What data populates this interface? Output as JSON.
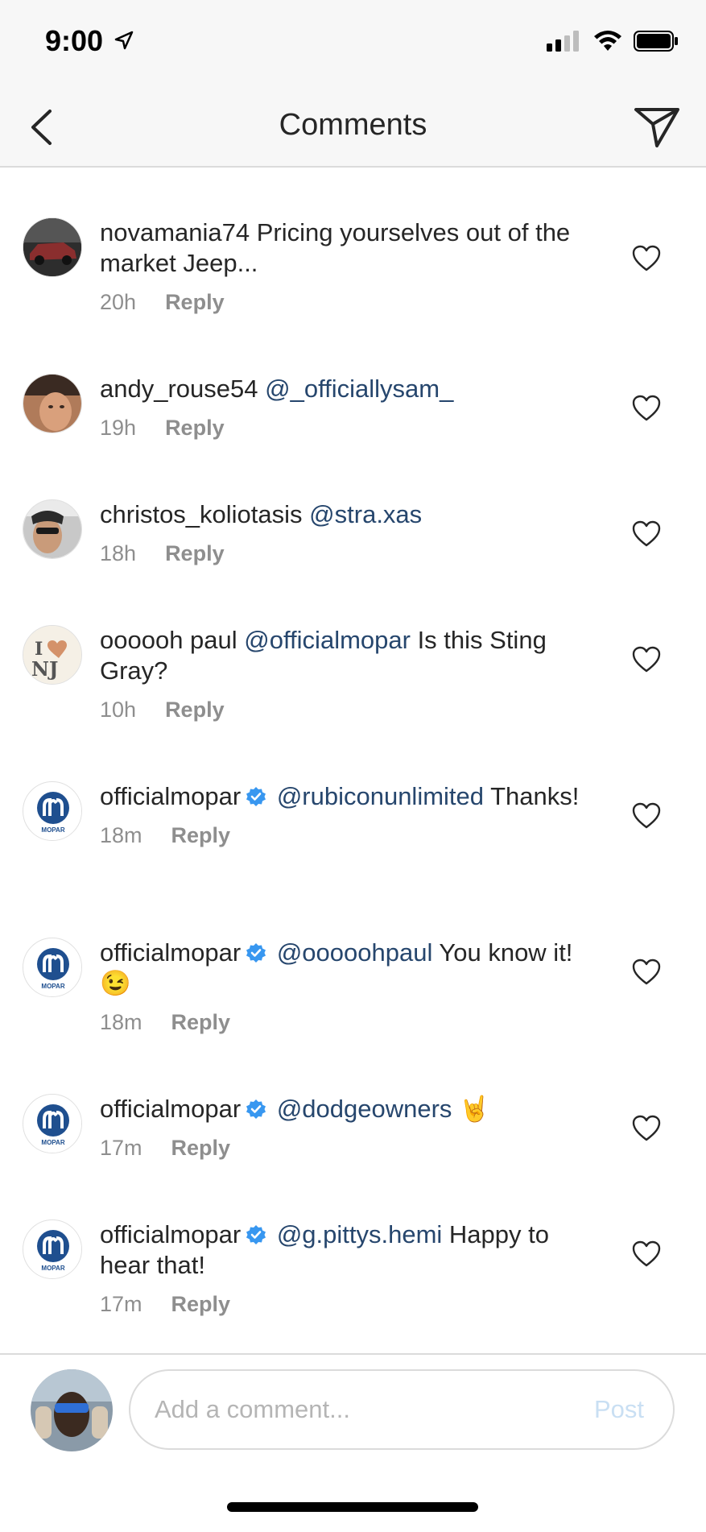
{
  "status": {
    "time": "9:00"
  },
  "nav": {
    "title": "Comments"
  },
  "comments": [
    {
      "username": "novamania74",
      "verified": false,
      "mention": "",
      "text": " Pricing yourselves out of the market Jeep...",
      "time": "20h",
      "reply": "Reply",
      "avatar": "car-avatar"
    },
    {
      "username": "andy_rouse54",
      "verified": false,
      "mention": "@_officiallysam_",
      "text": "",
      "time": "19h",
      "reply": "Reply",
      "avatar": "face-avatar"
    },
    {
      "username": "christos_koliotasis",
      "verified": false,
      "mention": "@stra.xas",
      "text": "",
      "time": "18h",
      "reply": "Reply",
      "avatar": "sunglasses-avatar"
    },
    {
      "username": "oooooh paul",
      "verified": false,
      "mention": "@officialmopar",
      "text": " Is this Sting Gray?",
      "time": "10h",
      "reply": "Reply",
      "avatar": "i-love-nj-avatar"
    },
    {
      "username": "officialmopar",
      "verified": true,
      "mention": "@rubiconunlimited",
      "text": " Thanks!",
      "time": "18m",
      "reply": "Reply",
      "avatar": "mopar-logo-avatar"
    },
    {
      "username": "officialmopar",
      "verified": true,
      "mention": "@ooooohpaul",
      "text": " You know it! 😉",
      "time": "18m",
      "reply": "Reply",
      "avatar": "mopar-logo-avatar"
    },
    {
      "username": "officialmopar",
      "verified": true,
      "mention": "@dodgeowners",
      "text": " 🤘",
      "time": "17m",
      "reply": "Reply",
      "avatar": "mopar-logo-avatar"
    },
    {
      "username": "officialmopar",
      "verified": true,
      "mention": "@g.pittys.hemi",
      "text": " Happy to hear that!",
      "time": "17m",
      "reply": "Reply",
      "avatar": "mopar-logo-avatar"
    }
  ],
  "composer": {
    "placeholder": "Add a comment...",
    "post_label": "Post"
  },
  "icons": {
    "back": "chevron-left-icon",
    "send": "paper-plane-icon",
    "like": "heart-icon",
    "verified": "verified-badge-icon"
  },
  "colors": {
    "mention": "#26466d",
    "meta": "#8e8e8e",
    "verified": "#3897f0",
    "post_disabled": "#c9dff3"
  },
  "mopar_logo_text": "MOPAR",
  "nj_logo_text": "I NJ"
}
